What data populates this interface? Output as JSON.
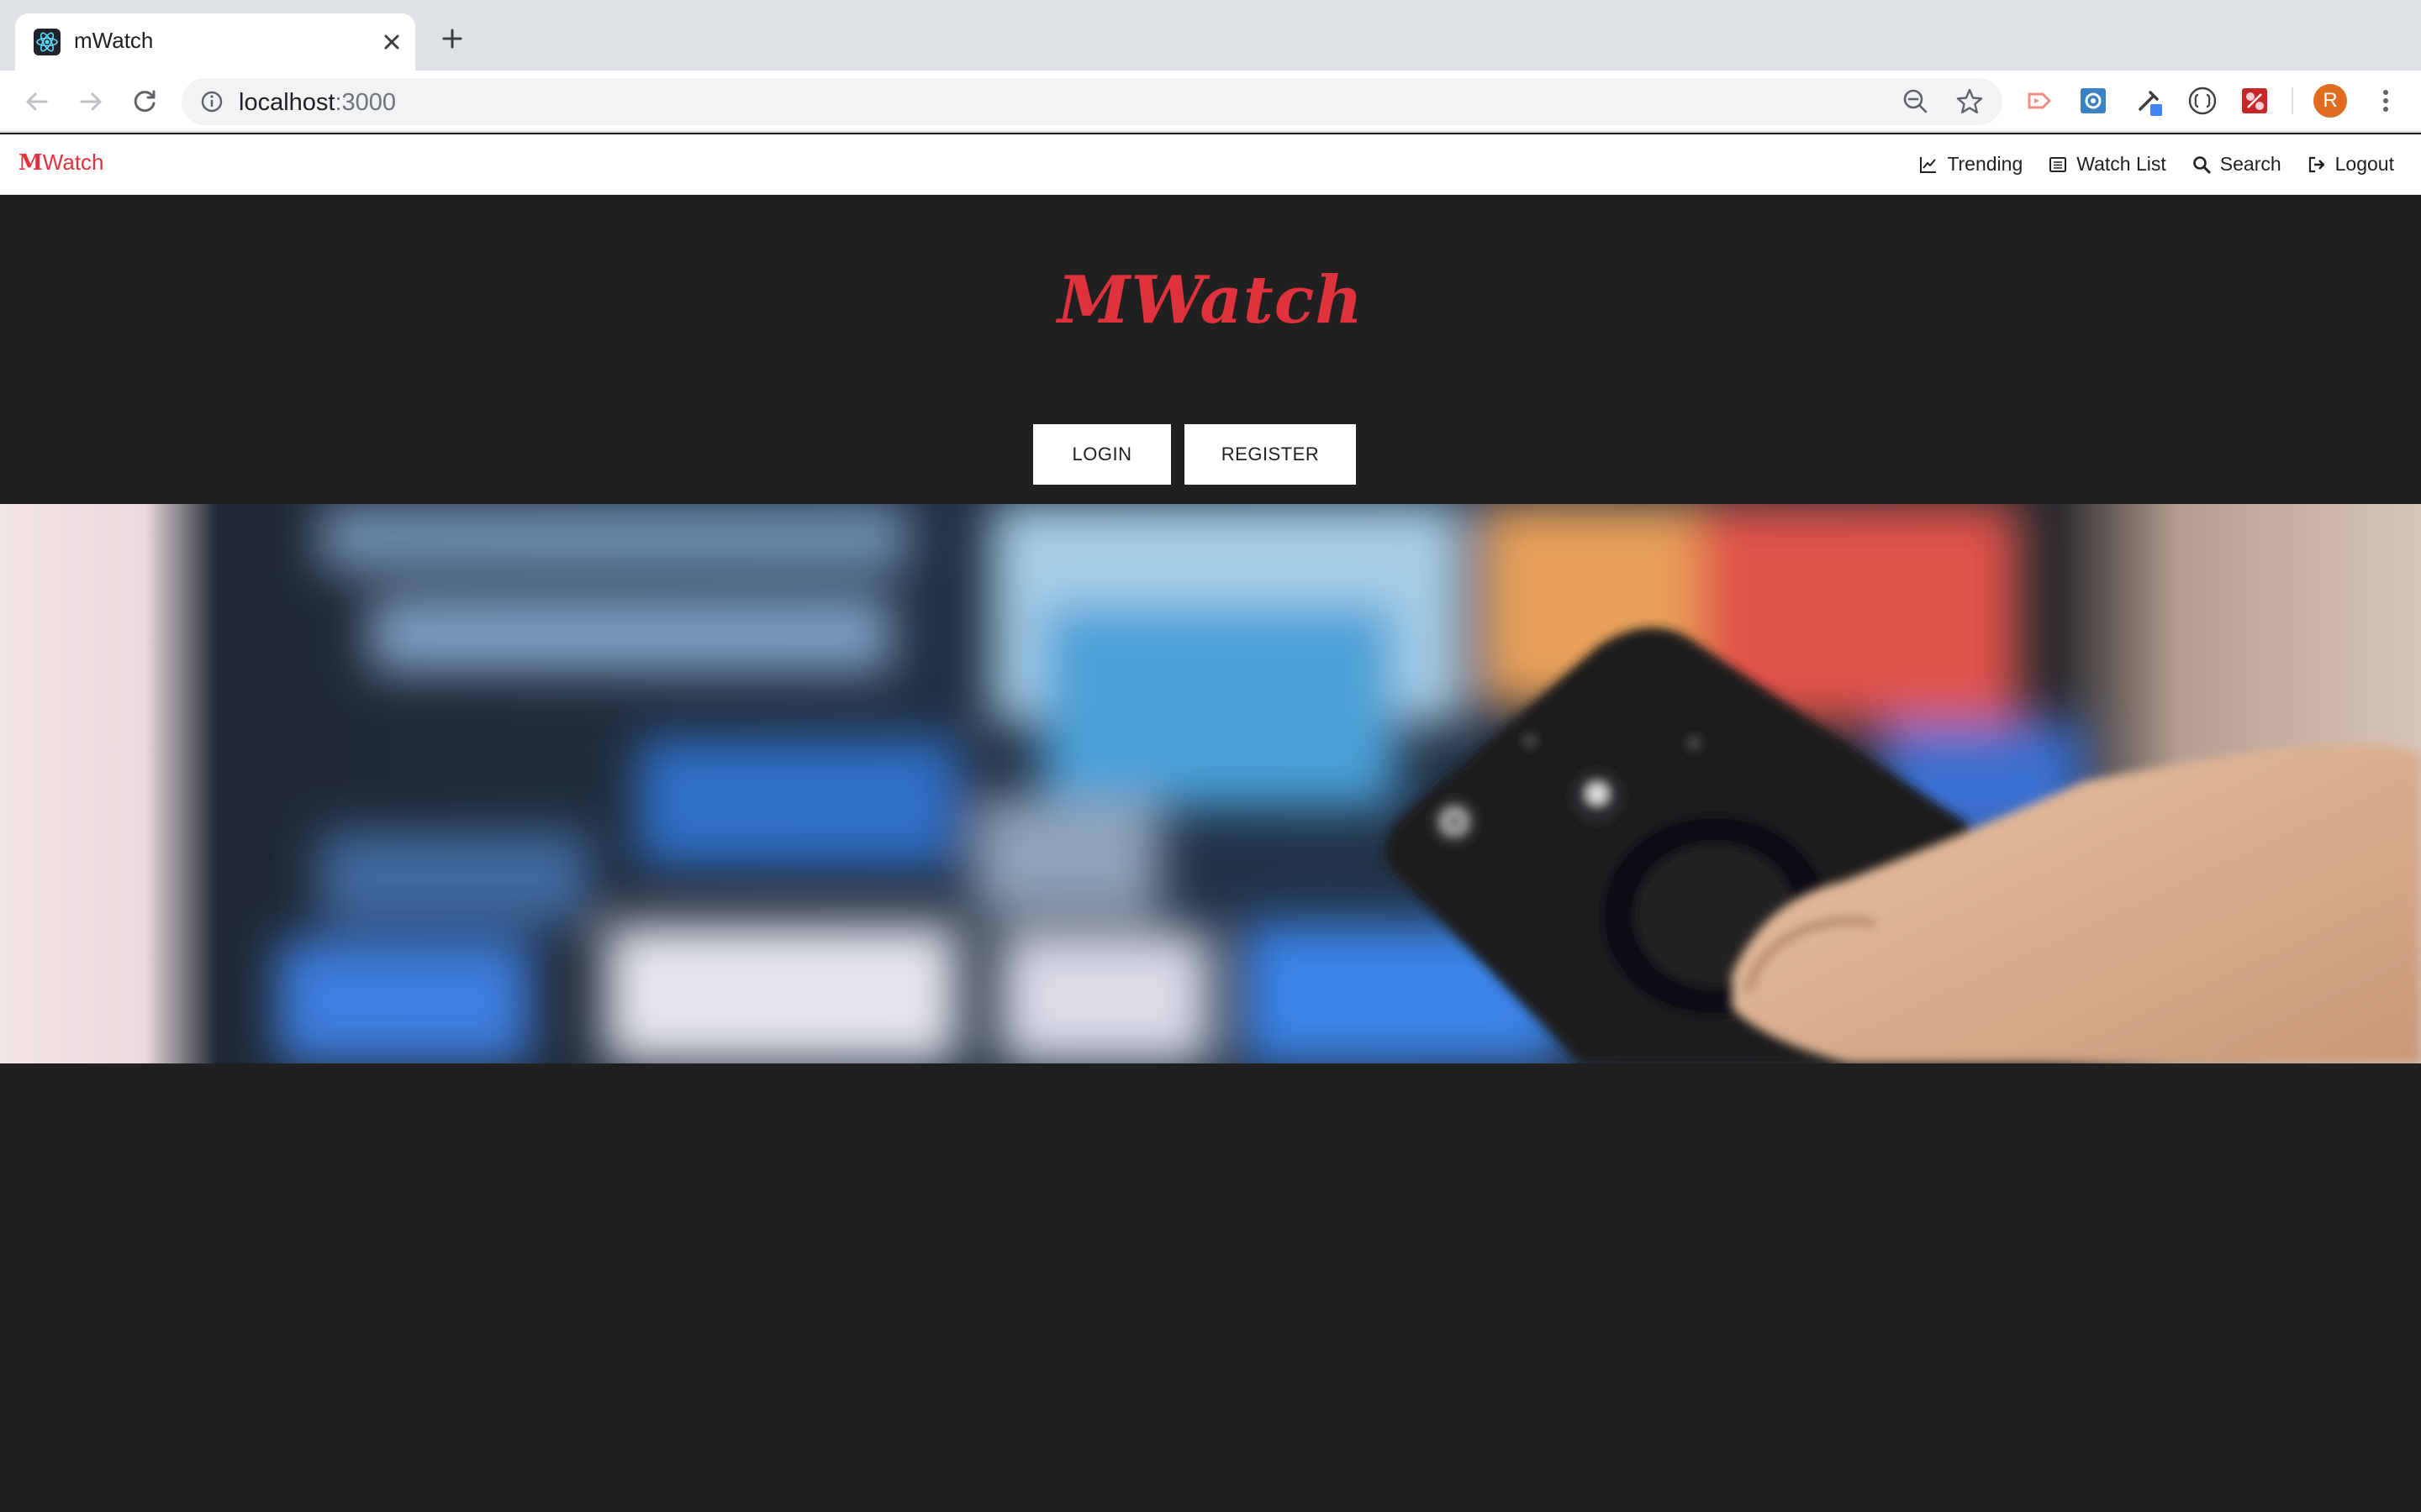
{
  "browser": {
    "tab_title": "mWatch",
    "url_host": "localhost",
    "url_port": ":3000",
    "profile_initial": "R"
  },
  "navbar": {
    "brand_m": "M",
    "brand_rest": "Watch",
    "links": [
      {
        "label": "Trending",
        "icon": "chart-icon"
      },
      {
        "label": "Watch List",
        "icon": "list-icon"
      },
      {
        "label": "Search",
        "icon": "search-icon"
      },
      {
        "label": "Logout",
        "icon": "logout-icon"
      }
    ]
  },
  "hero": {
    "logo": "MWatch",
    "login_label": "LOGIN",
    "register_label": "REGISTER"
  },
  "colors": {
    "accent": "#e0323c",
    "background": "#202020"
  }
}
